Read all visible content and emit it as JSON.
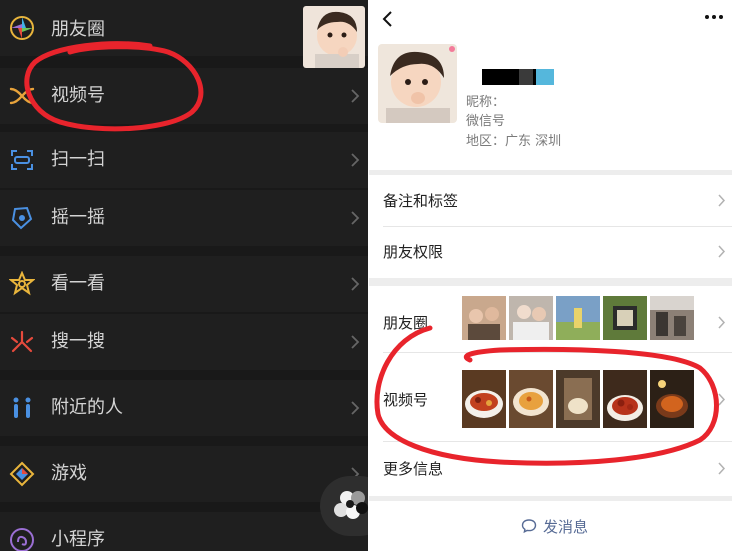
{
  "left_panel": {
    "items": [
      {
        "label": "朋友圈",
        "icon": "moments-icon"
      },
      {
        "label": "视频号",
        "icon": "channels-icon"
      },
      {
        "label": "扫一扫",
        "icon": "scan-icon"
      },
      {
        "label": "摇一摇",
        "icon": "shake-icon"
      },
      {
        "label": "看一看",
        "icon": "top-stories-icon"
      },
      {
        "label": "搜一搜",
        "icon": "search-icon"
      },
      {
        "label": "附近的人",
        "icon": "people-nearby-icon"
      },
      {
        "label": "游戏",
        "icon": "games-icon"
      },
      {
        "label": "小程序",
        "icon": "mini-programs-icon"
      }
    ]
  },
  "profile": {
    "nickname_label": "昵称：",
    "wechat_id_label": "微信号",
    "region_label": "地区：广东 深圳",
    "rows": {
      "remark": "备注和标签",
      "permission": "朋友权限",
      "moments": "朋友圈",
      "channels": "视频号",
      "more": "更多信息"
    },
    "send_message": "发消息"
  },
  "colors": {
    "dark_bg": "#191919",
    "annotation_red": "#e8242c",
    "wechat_link_blue": "#576b95"
  }
}
